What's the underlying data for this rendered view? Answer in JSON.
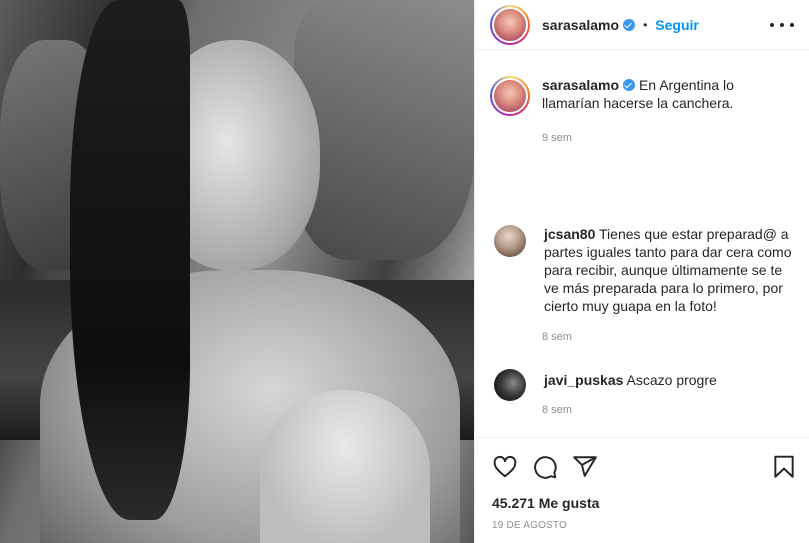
{
  "post": {
    "author": {
      "username": "sarasalamo",
      "verified": true,
      "follow_label": "Seguir",
      "separator": "•"
    },
    "caption": {
      "username": "sarasalamo",
      "text": "En Argentina lo llamarían hacerse la canchera.",
      "time": "9 sem"
    },
    "comments": [
      {
        "username": "jcsan80",
        "text": "Tienes que estar preparad@ a partes iguales tanto para dar cera como para recibir, aunque últimamente se te ve más preparada para lo primero, por cierto muy guapa en la foto!",
        "time": "8 sem"
      },
      {
        "username": "javi_puskas",
        "text": "Ascazo progre",
        "time": "8 sem"
      }
    ],
    "likes": "45.271 Me gusta",
    "date": "19 DE AGOSTO",
    "icons": {
      "more": "more-options-icon",
      "verified": "verified-badge-icon",
      "like": "heart-icon",
      "comment": "comment-icon",
      "share": "share-icon",
      "save": "bookmark-icon"
    },
    "colors": {
      "follow": "#0095f6",
      "verified": "#3897f0",
      "muted_text": "#8e8e8e",
      "text": "#262626"
    }
  }
}
